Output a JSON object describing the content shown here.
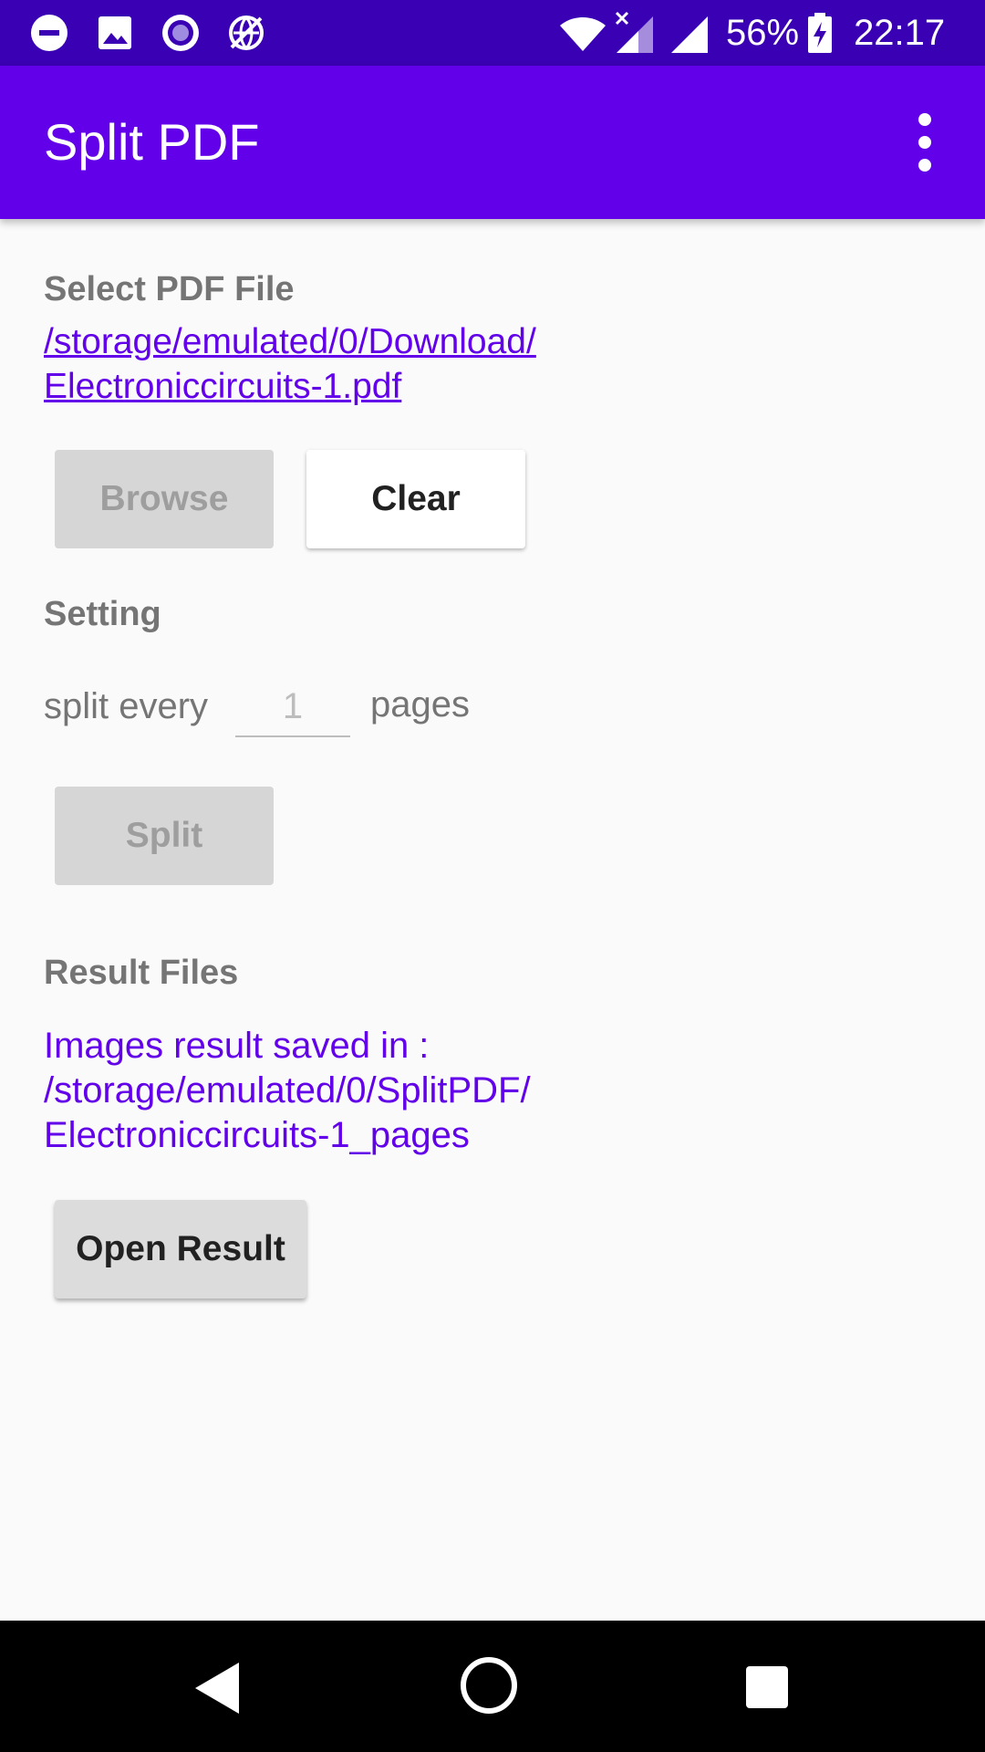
{
  "status_bar": {
    "battery": "56%",
    "time": "22:17",
    "left_icons": [
      "do-not-disturb-icon",
      "image-icon",
      "record-icon",
      "vpn-globe-icon"
    ],
    "right_icons": [
      "wifi-icon",
      "signal-no-data-icon",
      "signal-icon",
      "battery-charging-icon"
    ]
  },
  "app_bar": {
    "title": "Split PDF",
    "overflow_icon": "more-vert-icon"
  },
  "select_section": {
    "label": "Select PDF File",
    "file_path_line1": "/storage/emulated/0/Download/",
    "file_path_line2": "Electroniccircuits-1.pdf",
    "browse_label": "Browse",
    "clear_label": "Clear"
  },
  "setting_section": {
    "label": "Setting",
    "split_every": "split every",
    "pages_value": "1",
    "pages_label": "pages",
    "split_label": "Split"
  },
  "result_section": {
    "label": "Result Files",
    "line1": "Images result saved in :",
    "line2": "/storage/emulated/0/SplitPDF/",
    "line3": "Electroniccircuits-1_pages",
    "open_label": "Open Result"
  },
  "nav_bar": {
    "icons": [
      "back-icon",
      "home-icon",
      "recents-icon"
    ]
  },
  "colors": {
    "status_bar": "#3a00b3",
    "app_bar": "#6200ea",
    "accent": "#6200ea",
    "background": "#fafafa"
  }
}
